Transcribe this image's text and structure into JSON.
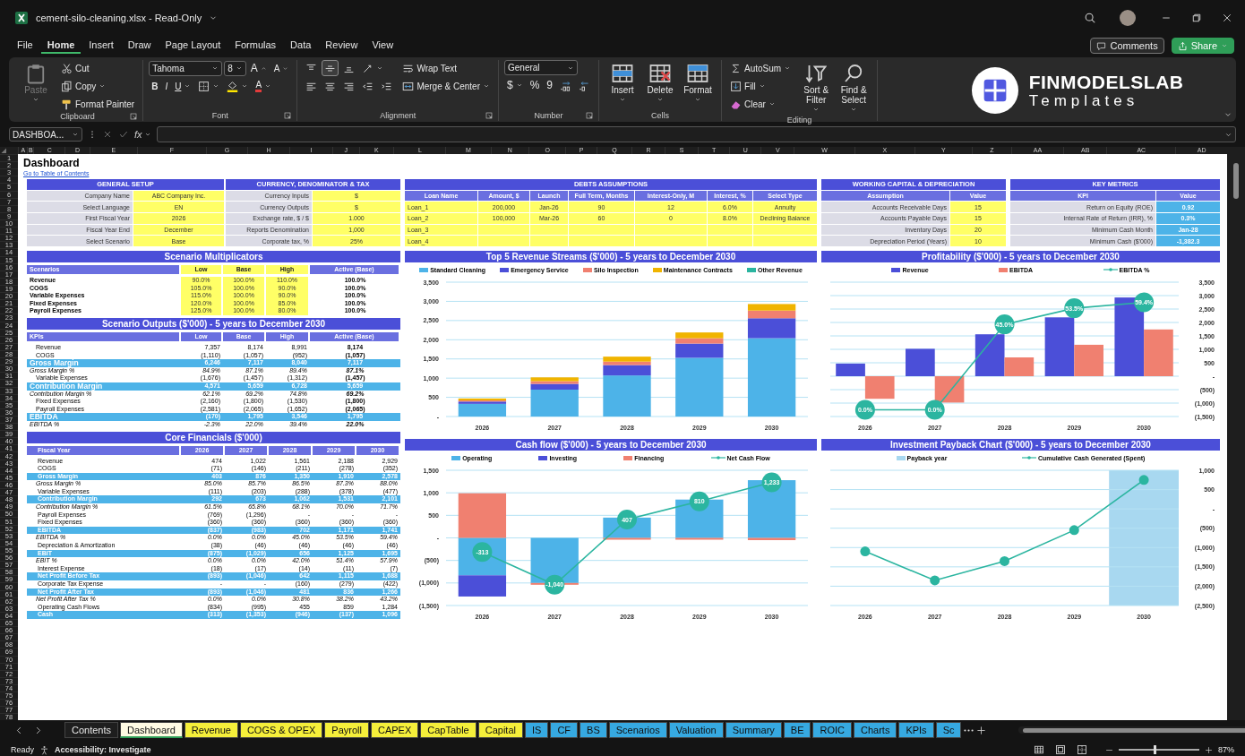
{
  "window": {
    "title": "cement-silo-cleaning.xlsx - Read-Only"
  },
  "menu": [
    {
      "label": "File",
      "selected": false
    },
    {
      "label": "Home",
      "selected": true
    },
    {
      "label": "Insert",
      "selected": false
    },
    {
      "label": "Draw",
      "selected": false
    },
    {
      "label": "Page Layout",
      "selected": false
    },
    {
      "label": "Formulas",
      "selected": false
    },
    {
      "label": "Data",
      "selected": false
    },
    {
      "label": "Review",
      "selected": false
    },
    {
      "label": "View",
      "selected": false
    }
  ],
  "actions": [
    {
      "kind": "outline",
      "label": "Comments"
    },
    {
      "kind": "primary",
      "label": "Share"
    }
  ],
  "ribbon": {
    "groups": [
      {
        "label": "Clipboard",
        "launcher": true,
        "sections": [
          {
            "kind": "large",
            "items": [
              {
                "kind": "paste",
                "label": "Paste",
                "dropdown": true,
                "disabled": true
              }
            ]
          },
          {
            "kind": "stack",
            "lines": [
              [
                {
                  "kind": "cut",
                  "label": "Cut"
                }
              ],
              [
                {
                  "kind": "copy",
                  "label": "Copy",
                  "dropdown": true
                }
              ],
              [
                {
                  "kind": "painter",
                  "label": "Format Painter"
                }
              ]
            ]
          }
        ]
      },
      {
        "label": "Font",
        "launcher": true,
        "sections": [
          {
            "kind": "stack",
            "lines": [
              [
                {
                  "kind": "select",
                  "label": "Tahoma"
                },
                {
                  "kind": "select",
                  "label": "8"
                },
                {
                  "kind": "grow",
                  "label": "A"
                },
                {
                  "kind": "shrink",
                  "label": "A"
                }
              ],
              [
                {
                  "kind": "bold",
                  "label": "B"
                },
                {
                  "kind": "italic",
                  "label": "I"
                },
                {
                  "kind": "underline",
                  "label": "U",
                  "dropdown": true
                },
                {
                  "kind": "borders",
                  "dropdown": true
                },
                {
                  "kind": "fill",
                  "dropdown": true
                },
                {
                  "kind": "fontcolor",
                  "label": "A",
                  "dropdown": true
                }
              ]
            ]
          }
        ]
      },
      {
        "label": "Alignment",
        "launcher": true,
        "sections": [
          {
            "kind": "stack",
            "lines": [
              [
                {
                  "kind": "vtop",
                  "selected": false
                },
                {
                  "kind": "vmid",
                  "selected": true
                },
                {
                  "kind": "vbot",
                  "selected": false
                },
                {
                  "kind": "orient",
                  "dropdown": true,
                  "selected": false
                }
              ],
              [
                {
                  "kind": "hleft",
                  "selected": false
                },
                {
                  "kind": "hcenter",
                  "selected": false
                },
                {
                  "kind": "hright",
                  "selected": false
                },
                {
                  "kind": "outdent",
                  "selected": false
                },
                {
                  "kind": "indent",
                  "selected": false
                }
              ]
            ]
          },
          {
            "kind": "stack",
            "lines": [
              [
                {
                  "kind": "wrap",
                  "label": "Wrap Text"
                }
              ],
              [
                {
                  "kind": "merge",
                  "label": "Merge & Center",
                  "dropdown": true
                }
              ]
            ]
          }
        ]
      },
      {
        "label": "Number",
        "launcher": true,
        "sections": [
          {
            "kind": "stack",
            "lines": [
              [
                {
                  "kind": "select",
                  "label": "General"
                }
              ],
              [
                {
                  "kind": "text",
                  "label": "$",
                  "dropdown": true
                },
                {
                  "kind": "text",
                  "label": "%"
                },
                {
                  "kind": "text",
                  "label": "9"
                },
                {
                  "kind": "incdec"
                },
                {
                  "kind": "decdec"
                }
              ]
            ]
          }
        ]
      },
      {
        "label": "Cells",
        "sections": [
          {
            "kind": "large",
            "items": [
              {
                "kind": "insc",
                "label": "Insert",
                "dropdown": true
              },
              {
                "kind": "delc",
                "label": "Delete",
                "dropdown": true
              },
              {
                "kind": "fmtc",
                "label": "Format",
                "dropdown": true
              }
            ]
          }
        ]
      },
      {
        "label": "Editing",
        "sections": [
          {
            "kind": "stack",
            "lines": [
              [
                {
                  "kind": "sum",
                  "label": "AutoSum",
                  "dropdown": true
                }
              ],
              [
                {
                  "kind": "filldown",
                  "label": "Fill",
                  "dropdown": true
                }
              ],
              [
                {
                  "kind": "eraser",
                  "label": "Clear",
                  "dropdown": true
                }
              ]
            ]
          },
          {
            "kind": "large",
            "items": [
              {
                "kind": "sort",
                "label": "Sort & Filter",
                "dropdown": true
              },
              {
                "kind": "find",
                "label": "Find & Select",
                "dropdown": true
              }
            ]
          }
        ]
      }
    ],
    "logo": {
      "name": "FINMODELSLAB",
      "tagline": "Templates"
    }
  },
  "formula_bar": {
    "name_box": "DASHBOA...",
    "fx": "fx"
  },
  "columns": [
    "A",
    "B",
    "C",
    "D",
    "E",
    "F",
    "G",
    "H",
    "I",
    "J",
    "K",
    "L",
    "M",
    "N",
    "O",
    "P",
    "Q",
    "R",
    "S",
    "T",
    "U",
    "V",
    "W",
    "X",
    "Y",
    "Z",
    "AA",
    "AB",
    "AC",
    "AD"
  ],
  "rows": [
    "1",
    "2",
    "3",
    "4",
    "5",
    "6",
    "7",
    "8",
    "9",
    "10",
    "11",
    "12",
    "13",
    "14",
    "15",
    "16",
    "17",
    "18",
    "19",
    "20",
    "21",
    "22",
    "23",
    "24",
    "25",
    "26",
    "27",
    "28",
    "29",
    "30",
    "31",
    "32",
    "33",
    "34",
    "35",
    "36",
    "37",
    "38",
    "39",
    "40",
    "41",
    "42",
    "43",
    "44",
    "45",
    "46",
    "47",
    "48",
    "49",
    "50",
    "51",
    "52",
    "53",
    "54",
    "55",
    "56",
    "57",
    "58",
    "59",
    "60",
    "61",
    "62",
    "63",
    "64",
    "65",
    "66",
    "67",
    "68",
    "69",
    "70",
    "71",
    "72",
    "73",
    "74",
    "75",
    "76",
    "77",
    "78"
  ],
  "sheet": {
    "title": "Dashboard",
    "link": "Go to Table of Contents",
    "general_setup": {
      "title": "GENERAL SETUP",
      "rows": [
        [
          "Company Name",
          "ABC Company Inc."
        ],
        [
          "Select Language",
          "EN"
        ],
        [
          "First Fiscal Year",
          "2026"
        ],
        [
          "Fiscal Year End",
          "December"
        ],
        [
          "Select Scenario",
          "Base"
        ]
      ]
    },
    "currency": {
      "title": "CURRENCY, DENOMINATOR & TAX",
      "rows": [
        [
          "Currency Inputs",
          "$"
        ],
        [
          "Currency Outputs",
          "$"
        ],
        [
          "Exchange rate, $ / $",
          "1.000"
        ],
        [
          "Reports Denomination",
          "1,000"
        ],
        [
          "Corporate tax, %",
          "25%"
        ]
      ]
    },
    "debts": {
      "title": "DEBTS ASSUMPTIONS",
      "columns": [
        "Loan Name",
        "Amount, $",
        "Launch",
        "Full Term, Months",
        "Interest-Only, M",
        "Interest, %",
        "Select Type"
      ],
      "rows": [
        [
          "Loan_1",
          "200,000",
          "Jan-26",
          "90",
          "12",
          "6.0%",
          "Annuity"
        ],
        [
          "Loan_2",
          "100,000",
          "Mar-26",
          "60",
          "0",
          "8.0%",
          "Declining Balance"
        ],
        [
          "Loan_3"
        ],
        [
          "Loan_4"
        ]
      ]
    },
    "working_capital": {
      "title": "WORKING CAPITAL & DEPRECIATION",
      "columns": [
        "Assumption",
        "Value"
      ],
      "rows": [
        [
          "Accounts Receivable Days",
          "15"
        ],
        [
          "Accounts Payable Days",
          "15"
        ],
        [
          "Inventory Days",
          "20"
        ],
        [
          "Depreciation Period (Years)",
          "10"
        ]
      ]
    },
    "key_metrics": {
      "title": "KEY METRICS",
      "columns": [
        "KPI",
        "Value"
      ],
      "rows": [
        [
          "Return on Equity (ROE)",
          "0.92"
        ],
        [
          "Internal Rate of Return (IRR), %",
          "0.3%"
        ],
        [
          "Minimum Cash Month",
          "Jan-28"
        ],
        [
          "Minimum Cash ($'000)",
          "-1,382.3"
        ]
      ]
    },
    "multipliers": {
      "title": "Scenario Multiplicators",
      "columns": [
        "Scenarios",
        "Low",
        "Base",
        "High",
        "Active (Base)"
      ],
      "rows": [
        [
          "Revenue",
          "90.0%",
          "100.0%",
          "110.0%",
          "100.0%"
        ],
        [
          "COGS",
          "105.0%",
          "100.0%",
          "90.0%",
          "100.0%"
        ],
        [
          "Variable Expenses",
          "115.0%",
          "100.0%",
          "90.0%",
          "100.0%"
        ],
        [
          "Fixed Expenses",
          "120.0%",
          "100.0%",
          "85.0%",
          "100.0%"
        ],
        [
          "Payroll Expenses",
          "125.0%",
          "100.0%",
          "80.0%",
          "100.0%"
        ]
      ]
    },
    "scenario_outputs": {
      "title": "Scenario Outputs ($'000) - 5 years to December 2030",
      "columns": [
        "KPIs",
        "Low",
        "Base",
        "High",
        "Active (Base)"
      ],
      "rows": [
        {
          "kind": "item",
          "cells": [
            "Revenue",
            "7,357",
            "8,174",
            "8,991",
            "8,174"
          ]
        },
        {
          "kind": "item",
          "cells": [
            "COGS",
            "(1,110)",
            "(1,057)",
            "(952)",
            "(1,057)"
          ]
        },
        {
          "kind": "total",
          "cells": [
            "Gross Margin",
            "6,246",
            "7,117",
            "8,040",
            "7,117"
          ]
        },
        {
          "kind": "pct",
          "cells": [
            "Gross Margin %",
            "84.9%",
            "87.1%",
            "89.4%",
            "87.1%"
          ]
        },
        {
          "kind": "item",
          "cells": [
            "Variable Expenses",
            "(1,676)",
            "(1,457)",
            "(1,312)",
            "(1,457)"
          ]
        },
        {
          "kind": "total",
          "cells": [
            "Contribution Margin",
            "4,571",
            "5,659",
            "6,728",
            "5,659"
          ]
        },
        {
          "kind": "pct",
          "cells": [
            "Contribution Margin %",
            "62.1%",
            "69.2%",
            "74.8%",
            "69.2%"
          ]
        },
        {
          "kind": "item",
          "cells": [
            "Fixed Expenses",
            "(2,160)",
            "(1,800)",
            "(1,530)",
            "(1,800)"
          ]
        },
        {
          "kind": "item",
          "cells": [
            "Payroll Expenses",
            "(2,581)",
            "(2,065)",
            "(1,652)",
            "(2,065)"
          ]
        },
        {
          "kind": "total",
          "cells": [
            "EBITDA",
            "(170)",
            "1,795",
            "3,546",
            "1,795"
          ]
        },
        {
          "kind": "pct",
          "cells": [
            "EBITDA %",
            "-2.3%",
            "22.0%",
            "39.4%",
            "22.0%"
          ]
        }
      ]
    },
    "core_financials": {
      "title": "Core Financials ($'000)",
      "columns": [
        "Fiscal Year",
        "2026",
        "2027",
        "2028",
        "2029",
        "2030"
      ],
      "rows": [
        {
          "kind": "item",
          "cells": [
            "Revenue",
            "474",
            "1,022",
            "1,561",
            "2,188",
            "2,929"
          ]
        },
        {
          "kind": "item",
          "cells": [
            "COGS",
            "(71)",
            "(146)",
            "(211)",
            "(278)",
            "(352)"
          ]
        },
        {
          "kind": "total",
          "cells": [
            "Gross Margin",
            "403",
            "876",
            "1,350",
            "1,910",
            "2,578"
          ]
        },
        {
          "kind": "pct",
          "cells": [
            "Gross Margin %",
            "85.0%",
            "85.7%",
            "86.5%",
            "87.3%",
            "88.0%"
          ]
        },
        {
          "kind": "item",
          "cells": [
            "Variable Expenses",
            "(111)",
            "(203)",
            "(288)",
            "(378)",
            "(477)"
          ]
        },
        {
          "kind": "total",
          "cells": [
            "Contribution Margin",
            "292",
            "673",
            "1,062",
            "1,531",
            "2,101"
          ]
        },
        {
          "kind": "pct",
          "cells": [
            "Contribution Margin %",
            "61.5%",
            "65.8%",
            "68.1%",
            "70.0%",
            "71.7%"
          ]
        },
        {
          "kind": "item",
          "cells": [
            "Payroll Expenses",
            "(769)",
            "(1,296)",
            "-",
            "-",
            "-"
          ]
        },
        {
          "kind": "item",
          "cells": [
            "Fixed Expenses",
            "(360)",
            "(360)",
            "(360)",
            "(360)",
            "(360)"
          ]
        },
        {
          "kind": "total",
          "cells": [
            "EBITDA",
            "(837)",
            "(983)",
            "702",
            "1,171",
            "1,741"
          ]
        },
        {
          "kind": "pct",
          "cells": [
            "EBITDA %",
            "0.0%",
            "0.0%",
            "45.0%",
            "53.5%",
            "59.4%"
          ]
        },
        {
          "kind": "item",
          "cells": [
            "Depreciation & Amortization",
            "(38)",
            "(46)",
            "(46)",
            "(46)",
            "(46)"
          ]
        },
        {
          "kind": "total",
          "cells": [
            "EBIT",
            "(875)",
            "(1,029)",
            "656",
            "1,125",
            "1,695"
          ]
        },
        {
          "kind": "pct",
          "cells": [
            "EBIT %",
            "0.0%",
            "0.0%",
            "42.0%",
            "51.4%",
            "57.9%"
          ]
        },
        {
          "kind": "item",
          "cells": [
            "Interest Expense",
            "(18)",
            "(17)",
            "(14)",
            "(11)",
            "(7)"
          ]
        },
        {
          "kind": "total",
          "cells": [
            "Net Profit Before Tax",
            "(893)",
            "(1,046)",
            "642",
            "1,115",
            "1,688"
          ]
        },
        {
          "kind": "item",
          "cells": [
            "Corporate Tax Expense",
            "-",
            "-",
            "(160)",
            "(279)",
            "(422)"
          ]
        },
        {
          "kind": "total",
          "cells": [
            "Net Profit After Tax",
            "(893)",
            "(1,046)",
            "481",
            "836",
            "1,266"
          ]
        },
        {
          "kind": "pct",
          "cells": [
            "Net Profit After Tax %",
            "0.0%",
            "0.0%",
            "30.8%",
            "38.2%",
            "43.2%"
          ]
        },
        {
          "kind": "item",
          "cells": [
            "Operating Cash Flows",
            "(834)",
            "(995)",
            "455",
            "859",
            "1,284"
          ]
        },
        {
          "kind": "total",
          "cells": [
            "Cash",
            "(313)",
            "(1,353)",
            "(946)",
            "(137)",
            "1,096"
          ]
        }
      ]
    },
    "charts": [
      {
        "chart_data": {
          "type": "bar",
          "title": "Top 5 Revenue Streams ($'000) - 5 years to December 2030",
          "stacked": true,
          "grid": true,
          "legend": true,
          "categories": [
            "2026",
            "2027",
            "2028",
            "2029",
            "2030"
          ],
          "ylim": [
            0,
            3500
          ],
          "yticks": [
            {
              "value": 0,
              "label": "-"
            },
            {
              "value": 500,
              "label": "500"
            },
            {
              "value": 1000,
              "label": "1,000"
            },
            {
              "value": 1500,
              "label": "1,500"
            },
            {
              "value": 2000,
              "label": "2,000"
            },
            {
              "value": 2500,
              "label": "2,500"
            },
            {
              "value": 3000,
              "label": "3,000"
            },
            {
              "value": 3500,
              "label": "3,500"
            }
          ],
          "series": [
            {
              "name": "Standard Cleaning",
              "type": "bar",
              "color": "#4db3e8",
              "values": [
                330,
                700,
                1070,
                1530,
                2040
              ]
            },
            {
              "name": "Emergency Service",
              "type": "bar",
              "color": "#4b4fd8",
              "values": [
                60,
                150,
                270,
                370,
                520
              ]
            },
            {
              "name": "Silo Inspection",
              "type": "bar",
              "color": "#f08070",
              "values": [
                30,
                70,
                90,
                140,
                200
              ]
            },
            {
              "name": "Maintenance Contracts",
              "type": "bar",
              "color": "#f0b400",
              "values": [
                50,
                100,
                130,
                150,
                170
              ]
            },
            {
              "name": "Other Revenue",
              "type": "bar",
              "color": "#2bb5a0",
              "values": [
                0,
                0,
                0,
                0,
                0
              ]
            }
          ]
        }
      },
      {
        "chart_data": {
          "type": "bar",
          "title": "Profitability ($'000) - 5 years to December 2030",
          "stacked": false,
          "grid": true,
          "legend": true,
          "categories": [
            "2026",
            "2027",
            "2028",
            "2029",
            "2030"
          ],
          "ylim": [
            -1500,
            3500
          ],
          "yticks": [
            {
              "value": -1500,
              "label": "(1,500)"
            },
            {
              "value": -1000,
              "label": "(1,000)"
            },
            {
              "value": -500,
              "label": "(500)"
            },
            {
              "value": 0,
              "label": "-"
            },
            {
              "value": 500,
              "label": "500"
            },
            {
              "value": 1000,
              "label": "1,000"
            },
            {
              "value": 1500,
              "label": "1,500"
            },
            {
              "value": 2000,
              "label": "2,000"
            },
            {
              "value": 2500,
              "label": "2,500"
            },
            {
              "value": 3000,
              "label": "3,000"
            },
            {
              "value": 3500,
              "label": "3,500"
            }
          ],
          "value_labels": [
            "0.0%",
            "0.0%",
            "45.0%",
            "53.5%",
            "59.4%"
          ],
          "series": [
            {
              "name": "Revenue",
              "type": "bar",
              "color": "#4b4fd8",
              "values": [
                470,
                1020,
                1560,
                2190,
                2930
              ]
            },
            {
              "name": "EBITDA",
              "type": "bar",
              "color": "#f08070",
              "values": [
                -840,
                -980,
                700,
                1170,
                1740
              ]
            },
            {
              "name": "EBITDA %",
              "type": "line",
              "marker": true,
              "color": "#2bb5a0",
              "values": [
                -1250,
                -1250,
                1930,
                2530,
                2750
              ]
            }
          ]
        }
      },
      {
        "chart_data": {
          "type": "bar",
          "title": "Cash flow ($'000) - 5 years to December 2030",
          "stacked": true,
          "grid": true,
          "legend": true,
          "categories": [
            "2026",
            "2027",
            "2028",
            "2029",
            "2030"
          ],
          "ylim": [
            -1500,
            1500
          ],
          "yticks": [
            {
              "value": -1500,
              "label": "(1,500)"
            },
            {
              "value": -1000,
              "label": "(1,000)"
            },
            {
              "value": -500,
              "label": "(500)"
            },
            {
              "value": 0,
              "label": "-"
            },
            {
              "value": 500,
              "label": "500"
            },
            {
              "value": 1000,
              "label": "1,000"
            },
            {
              "value": 1500,
              "label": "1,500"
            }
          ],
          "value_labels": [
            "-313",
            "-1,040",
            "407",
            "810",
            "1,233"
          ],
          "series": [
            {
              "name": "Operating",
              "type": "bar",
              "color": "#4db3e8",
              "values": [
                -830,
                -1000,
                450,
                850,
                1280
              ]
            },
            {
              "name": "Investing",
              "type": "bar",
              "color": "#4b4fd8",
              "values": [
                -470,
                0,
                0,
                0,
                0
              ]
            },
            {
              "name": "Financing",
              "type": "bar",
              "color": "#f08070",
              "values": [
                990,
                -40,
                -40,
                -40,
                -50
              ]
            },
            {
              "name": "Net Cash Flow",
              "type": "line",
              "marker": true,
              "color": "#2bb5a0",
              "values": [
                -313,
                -1040,
                407,
                810,
                1233
              ]
            }
          ]
        }
      },
      {
        "payback": {
          "label": "Payback year",
          "color": "#a8d8f0",
          "category": "2030"
        },
        "chart_data": {
          "type": "line",
          "title": "Investment Payback Chart ($'000) - 5 years to December 2030",
          "grid": true,
          "legend": true,
          "categories": [
            "2026",
            "2027",
            "2028",
            "2029",
            "2030"
          ],
          "ylim": [
            -2500,
            1000
          ],
          "yticks": [
            {
              "value": -2500,
              "label": "(2,500)"
            },
            {
              "value": -2000,
              "label": "(2,000)"
            },
            {
              "value": -1500,
              "label": "(1,500)"
            },
            {
              "value": -1000,
              "label": "(1,000)"
            },
            {
              "value": -500,
              "label": "(500)"
            },
            {
              "value": 0,
              "label": "-"
            },
            {
              "value": 500,
              "label": "500"
            },
            {
              "value": 1000,
              "label": "1,000"
            }
          ],
          "series": [
            {
              "name": "Cumulative Cash Generated (Spent)",
              "type": "line",
              "marker": true,
              "color": "#2bb5a0",
              "values": [
                -1100,
                -1850,
                -1350,
                -550,
                750
              ]
            }
          ]
        }
      }
    ]
  },
  "sheet_tabs": [
    {
      "label": "Contents",
      "selected": false
    },
    {
      "label": "Dashboard",
      "selected": true
    },
    {
      "label": "Revenue",
      "selected": false,
      "color": "#f5ef3a"
    },
    {
      "label": "COGS & OPEX",
      "selected": false,
      "color": "#f5ef3a"
    },
    {
      "label": "Payroll",
      "selected": false,
      "color": "#f5ef3a"
    },
    {
      "label": "CAPEX",
      "selected": false,
      "color": "#f5ef3a"
    },
    {
      "label": "CapTable",
      "selected": false,
      "color": "#f5ef3a"
    },
    {
      "label": "Capital",
      "selected": false,
      "color": "#f5ef3a"
    },
    {
      "label": "IS",
      "selected": false,
      "color": "#36a9e1"
    },
    {
      "label": "CF",
      "selected": false,
      "color": "#36a9e1"
    },
    {
      "label": "BS",
      "selected": false,
      "color": "#36a9e1"
    },
    {
      "label": "Scenarios",
      "selected": false,
      "color": "#36a9e1"
    },
    {
      "label": "Valuation",
      "selected": false,
      "color": "#36a9e1"
    },
    {
      "label": "Summary",
      "selected": false,
      "color": "#36a9e1"
    },
    {
      "label": "BE",
      "selected": false,
      "color": "#36a9e1"
    },
    {
      "label": "ROIC",
      "selected": false,
      "color": "#36a9e1"
    },
    {
      "label": "Charts",
      "selected": false,
      "color": "#36a9e1"
    },
    {
      "label": "KPIs",
      "selected": false,
      "color": "#36a9e1"
    },
    {
      "label": "Sc",
      "selected": false,
      "color": "#36a9e1"
    }
  ],
  "status_bar": {
    "mode": "Ready",
    "accessibility": "Accessibility: Investigate",
    "zoom": {
      "level": 0.45,
      "reading": "87%"
    }
  }
}
